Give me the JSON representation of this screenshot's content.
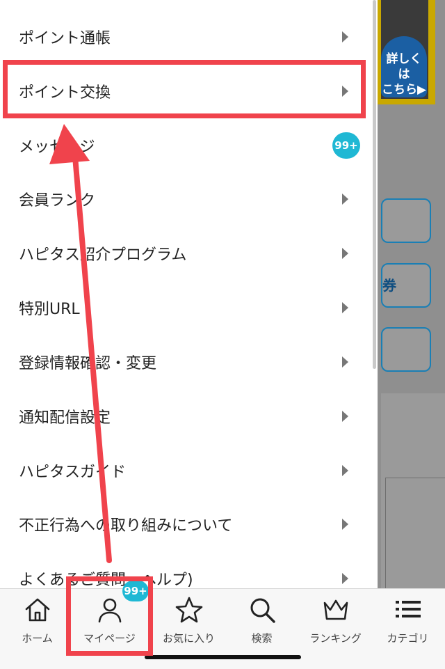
{
  "background": {
    "banner_text": "詳しくは\nこちら▶",
    "box_text": "券"
  },
  "menu": {
    "items": [
      {
        "label": "ポイント通帳"
      },
      {
        "label": "ポイント交換"
      },
      {
        "label": "メッセージ",
        "badge": "99+"
      },
      {
        "label": "会員ランク"
      },
      {
        "label": "ハピタス紹介プログラム"
      },
      {
        "label": "特別URL"
      },
      {
        "label": "登録情報確認・変更"
      },
      {
        "label": "通知配信設定"
      },
      {
        "label": "ハピタスガイド"
      },
      {
        "label": "不正行為への取り組みについて"
      },
      {
        "label": "よくあるご質問・ヘルプ)"
      }
    ]
  },
  "tabbar": {
    "tabs": [
      {
        "label": "ホーム",
        "icon": "home-icon"
      },
      {
        "label": "マイページ",
        "icon": "person-icon"
      },
      {
        "label": "お気に入り",
        "icon": "star-icon"
      },
      {
        "label": "検索",
        "icon": "search-icon"
      },
      {
        "label": "ランキング",
        "icon": "crown-icon"
      },
      {
        "label": "カテゴリ",
        "icon": "list-icon"
      }
    ],
    "mypage_badge": "99+"
  },
  "colors": {
    "highlight": "#f0434c",
    "badge": "#1fb8d4",
    "banner": "#c9a800"
  }
}
